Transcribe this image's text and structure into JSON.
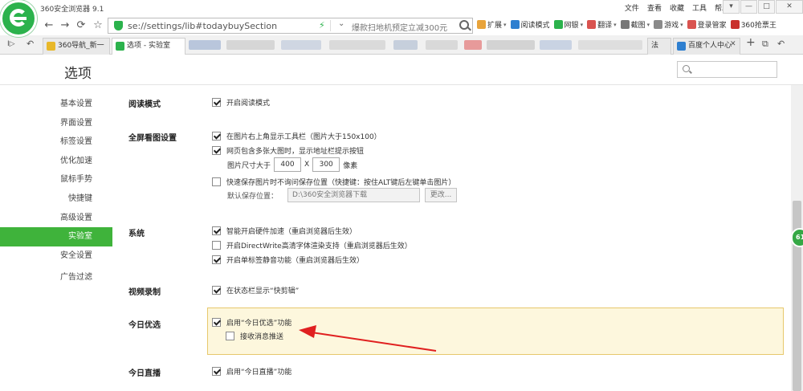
{
  "window": {
    "app_title": "360安全浏览器 9.1",
    "menus": [
      "文件",
      "查看",
      "收藏",
      "工具",
      "帮助"
    ],
    "controls": [
      "▾",
      "—",
      "□",
      "✕"
    ]
  },
  "toolbar": {
    "back": "←",
    "forward": "→",
    "refresh": "⟳",
    "home": "⌂",
    "star": "☆",
    "url": "se://settings/lib#todaybuySection",
    "bolt": "⚡",
    "dropdown": "⌄",
    "search_placeholder": "爆款扫地机预定立减300元",
    "tools": [
      {
        "label": "扩展",
        "color": "#e8a33a",
        "caret": true
      },
      {
        "label": "阅读模式",
        "color": "#2e7fd0",
        "caret": false
      },
      {
        "label": "网银",
        "color": "#2bb24c",
        "caret": true
      },
      {
        "label": "翻译",
        "color": "#d9534f",
        "caret": true
      },
      {
        "label": "截图",
        "color": "#777777",
        "caret": true
      },
      {
        "label": "游戏",
        "color": "#8a8a8a",
        "caret": true
      },
      {
        "label": "登录管家",
        "color": "#d9534f",
        "caret": false
      },
      {
        "label": "360抢票王",
        "color": "#c9302c",
        "caret": false
      }
    ]
  },
  "tabs": {
    "sidebar_toggle": "I▷",
    "items": [
      {
        "label": "360导航_新一",
        "icon_color": "#e8b82a"
      },
      {
        "label": "选项 - 实验室",
        "icon_color": "#2bb24c"
      },
      {
        "label": "法",
        "icon_color": "#999999"
      },
      {
        "label": "百度个人中心",
        "icon_color": "#2e7fd0"
      }
    ],
    "close": "✕",
    "new_tab": "+",
    "restore": "↶",
    "more": "⧉"
  },
  "page": {
    "title": "选项",
    "search_placeholder": ""
  },
  "sidebar": {
    "items": [
      {
        "label": "基本设置",
        "active": false
      },
      {
        "label": "界面设置",
        "active": false
      },
      {
        "label": "标签设置",
        "active": false
      },
      {
        "label": "优化加速",
        "active": false
      },
      {
        "label": "鼠标手势",
        "active": false
      },
      {
        "label": "快捷键",
        "active": false
      },
      {
        "label": "高级设置",
        "active": false
      },
      {
        "label": "实验室",
        "active": true
      },
      {
        "label": "安全设置",
        "active": false
      },
      {
        "label": "广告过滤",
        "active": false
      }
    ]
  },
  "sections": {
    "reading": {
      "label": "阅读模式",
      "options": [
        {
          "text": "开启阅读模式",
          "checked": true
        }
      ]
    },
    "fullscreen": {
      "label": "全屏看图设置",
      "options": [
        {
          "text": "在图片右上角显示工具栏（图片大于150x100）",
          "checked": true
        },
        {
          "text": "网页包含多张大图时，显示地址栏提示按钮",
          "checked": true
        },
        {
          "text": "快速保存图片时不询问保存位置（快捷键：按住ALT键后左键单击图片）",
          "checked": false
        }
      ],
      "size_label": "图片尺寸大于",
      "width": "400",
      "times": "X",
      "height": "300",
      "unit": "像素",
      "path_label": "默认保存位置：",
      "path_value": "D:\\360安全浏览器下载",
      "change_button": "更改..."
    },
    "system": {
      "label": "系统",
      "options": [
        {
          "text": "智能开启硬件加速（重启浏览器后生效）",
          "checked": true
        },
        {
          "text": "开启DirectWrite高清字体渲染支持（重启浏览器后生效）",
          "checked": false
        },
        {
          "text": "开启单标签静音功能（重启浏览器后生效）",
          "checked": true
        }
      ]
    },
    "video": {
      "label": "视频录制",
      "options": [
        {
          "text": "在状态栏显示“快剪辑”",
          "checked": true
        }
      ]
    },
    "today_pick": {
      "label": "今日优选",
      "options": [
        {
          "text": "启用“今日优选”功能",
          "checked": true
        },
        {
          "text": "接收消息推送",
          "checked": false
        }
      ]
    },
    "today_live": {
      "label": "今日直播",
      "options": [
        {
          "text": "启用“今日直播”功能",
          "checked": true
        }
      ]
    }
  },
  "float_badge": "61",
  "colors": {
    "accent_green": "#3fb33b",
    "highlight_bg": "#fdf7dd",
    "highlight_border": "#e7c86c",
    "annotation_arrow": "#e02020"
  }
}
